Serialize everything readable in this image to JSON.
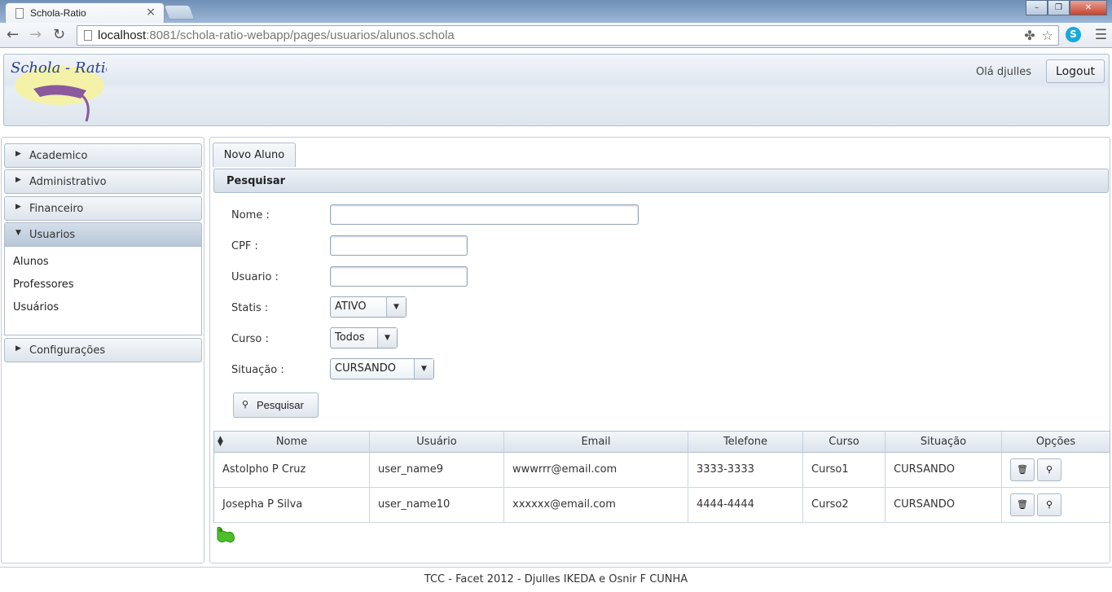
{
  "browser": {
    "tab_title": "Schola-Ratio",
    "url_host": "localhost",
    "url_rest": ":8081/schola-ratio-webapp/pages/usuarios/alunos.schola"
  },
  "header": {
    "logo_text": "Schola - Ratio",
    "greeting": "Olá djulles",
    "logout_label": "Logout"
  },
  "sidebar": {
    "sections": [
      {
        "label": "Academico"
      },
      {
        "label": "Administrativo"
      },
      {
        "label": "Financeiro"
      },
      {
        "label": "Usuarios"
      },
      {
        "label": "Configurações"
      }
    ],
    "usuarios_links": [
      "Alunos",
      "Professores",
      "Usuários"
    ]
  },
  "main": {
    "tab_label": "Novo Aluno",
    "search": {
      "legend": "Pesquisar",
      "labels": {
        "nome": "Nome :",
        "cpf": "CPF :",
        "usuario": "Usuario :",
        "statis": "Statis :",
        "curso": "Curso :",
        "situacao": "Situação :"
      },
      "values": {
        "nome": "",
        "cpf": "",
        "usuario": ""
      },
      "selects": {
        "statis": "ATIVO",
        "curso": "Todos",
        "situacao": "CURSANDO"
      },
      "button_label": "Pesquisar"
    },
    "table": {
      "columns": [
        "Nome",
        "Usuário",
        "Email",
        "Telefone",
        "Curso",
        "Situação",
        "Opções"
      ],
      "rows": [
        {
          "nome": "Astolpho P Cruz",
          "usuario": "user_name9",
          "email": "wwwrrr@email.com",
          "telefone": "3333-3333",
          "curso": "Curso1",
          "situacao": "CURSANDO"
        },
        {
          "nome": "Josepha P Silva",
          "usuario": "user_name10",
          "email": "xxxxxx@email.com",
          "telefone": "4444-4444",
          "curso": "Curso2",
          "situacao": "CURSANDO"
        }
      ]
    }
  },
  "footer": {
    "text": "TCC - Facet 2012 - Djulles IKEDA e Osnir F CUNHA"
  }
}
